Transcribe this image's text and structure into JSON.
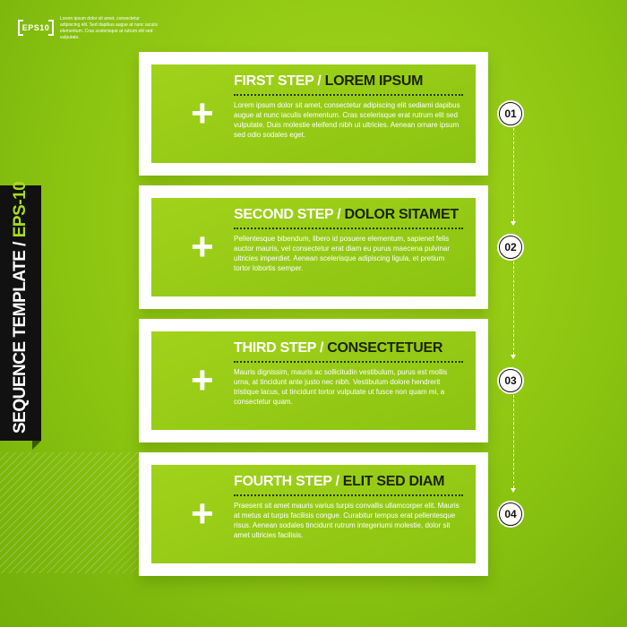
{
  "header": {
    "badge": "EPS10",
    "intro": "Lorem ipsum dolor sit amet, consectetur adipiscing elit. Sed dapibus augue at nunc iaculis elementum. Cras scelerisque at rutrum elit sed vulputate."
  },
  "sidebar": {
    "title_main": "SEQUENCE TEMPLATE / ",
    "title_accent": "EPS-10"
  },
  "steps": [
    {
      "number": "01",
      "title_light": "FIRST STEP / ",
      "title_dark": "LOREM IPSUM",
      "body": "Lorem ipsum dolor sit amet, consectetur adipiscing elit sediami dapibus augue at nunc iaculis elementum. Cras scelerisque erat rutrum elit sed vulputate. Duis molestie eleifend nibh ut ultricies. Aenean ornare ipsum sed odio sodales eget."
    },
    {
      "number": "02",
      "title_light": "SECOND STEP / ",
      "title_dark": "DOLOR SITAMET",
      "body": "Pellentesque bibendum, libero id posuere elementum, sapienet felis auctor mauris, vel consectetur erat diam eu purus maecena pulvinar ultricies imperdiet. Aenean scelerisque adipiscing ligula, et pretium tortor lobortis semper."
    },
    {
      "number": "03",
      "title_light": "THIRD STEP / ",
      "title_dark": "CONSECTETUER",
      "body": "Mauris dignissim, mauris ac sollicitudin vestibulum, purus est mollis urna, at tincidunt ante justo nec nibh. Vestibulum dolore hendrerit tristique lacus, ut tincidunt tortor vulputate ut fusce non quam mi, a consectetur quam."
    },
    {
      "number": "04",
      "title_light": "FOURTH STEP / ",
      "title_dark": "ELIT SED DIAM",
      "body": "Praesent sit amet mauris varius turpis convallis ullamcorper elit. Mauris at metus at turpis facilisis congue. Curabitur tempus erat pellentesque risus. Aenean sodales tincidunt rutrum integeriumi molestie, dolor sit amet ultricies facilisis."
    }
  ],
  "colors": {
    "background": "#8cc511",
    "accent": "#a8dc1e",
    "dark": "#111111"
  },
  "icons": {
    "step": "plus-icon"
  }
}
